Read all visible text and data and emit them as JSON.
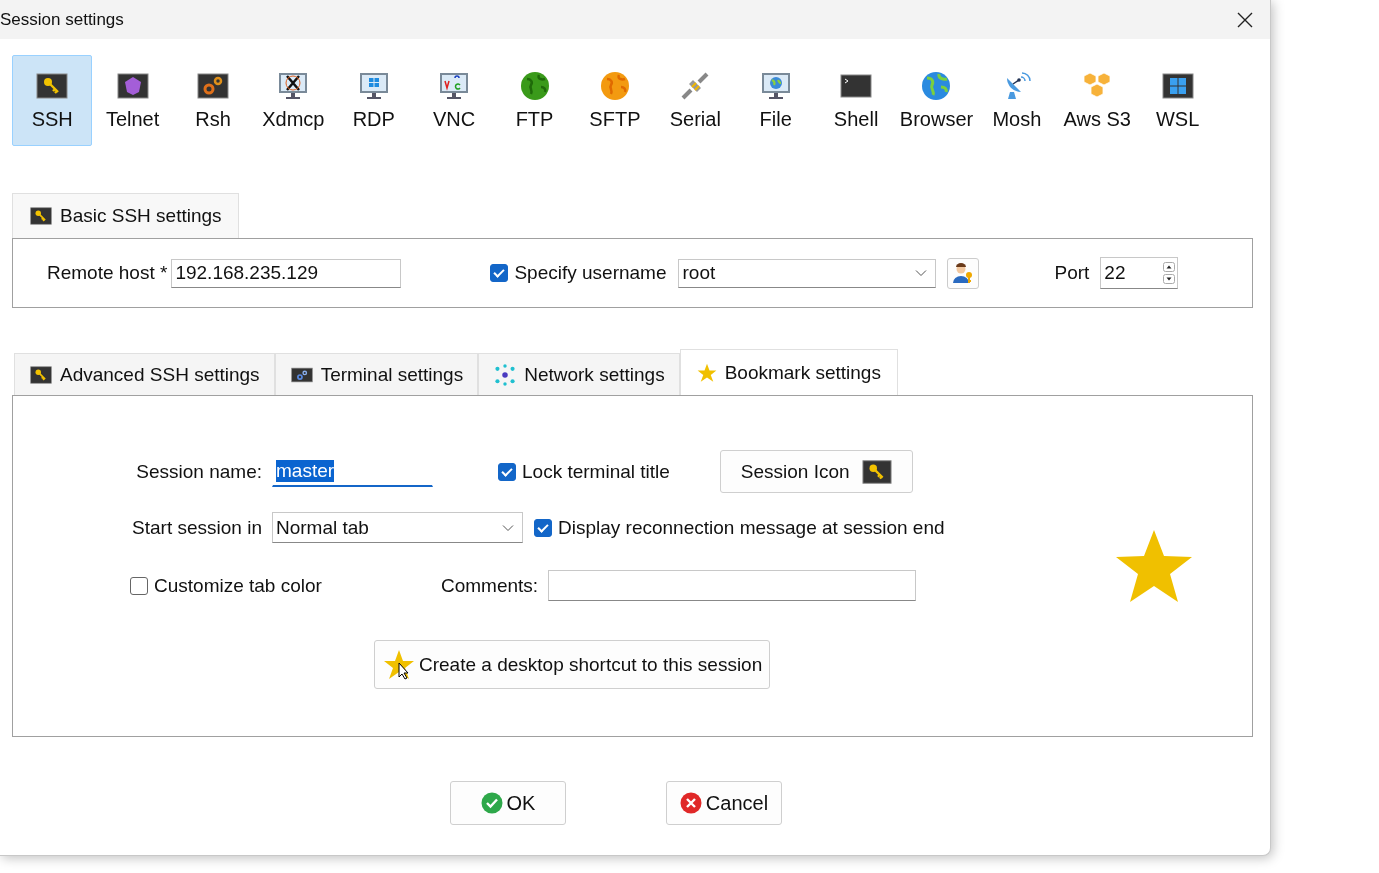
{
  "window": {
    "title": "Session settings"
  },
  "session_types": [
    {
      "label": "SSH",
      "selected": true
    },
    {
      "label": "Telnet",
      "selected": false
    },
    {
      "label": "Rsh",
      "selected": false
    },
    {
      "label": "Xdmcp",
      "selected": false
    },
    {
      "label": "RDP",
      "selected": false
    },
    {
      "label": "VNC",
      "selected": false
    },
    {
      "label": "FTP",
      "selected": false
    },
    {
      "label": "SFTP",
      "selected": false
    },
    {
      "label": "Serial",
      "selected": false
    },
    {
      "label": "File",
      "selected": false
    },
    {
      "label": "Shell",
      "selected": false
    },
    {
      "label": "Browser",
      "selected": false
    },
    {
      "label": "Mosh",
      "selected": false
    },
    {
      "label": "Aws S3",
      "selected": false
    },
    {
      "label": "WSL",
      "selected": false
    }
  ],
  "basic_tab": {
    "label": "Basic SSH settings"
  },
  "basic": {
    "remote_host_label": "Remote host *",
    "remote_host": "192.168.235.129",
    "specify_username": {
      "label": "Specify username",
      "checked": true
    },
    "username": "root",
    "port_label": "Port",
    "port": "22"
  },
  "tabs": [
    {
      "label": "Advanced SSH settings",
      "selected": false
    },
    {
      "label": "Terminal settings",
      "selected": false
    },
    {
      "label": "Network settings",
      "selected": false
    },
    {
      "label": "Bookmark settings",
      "selected": true
    }
  ],
  "bookmark": {
    "session_name_label": "Session name:",
    "session_name": "master",
    "lock_title": {
      "label": "Lock terminal title",
      "checked": true
    },
    "session_icon_button": "Session Icon",
    "start_session_label": "Start session in",
    "start_session": "Normal tab",
    "display_reconnect": {
      "label": "Display reconnection message at session end",
      "checked": true
    },
    "customize_tab_color": {
      "label": "Customize tab color",
      "checked": false
    },
    "comments_label": "Comments:",
    "shortcut_button": "Create a desktop shortcut to this session"
  },
  "buttons": [
    {
      "label": "OK",
      "kind": "ok"
    },
    {
      "label": "Cancel",
      "kind": "cancel"
    }
  ]
}
